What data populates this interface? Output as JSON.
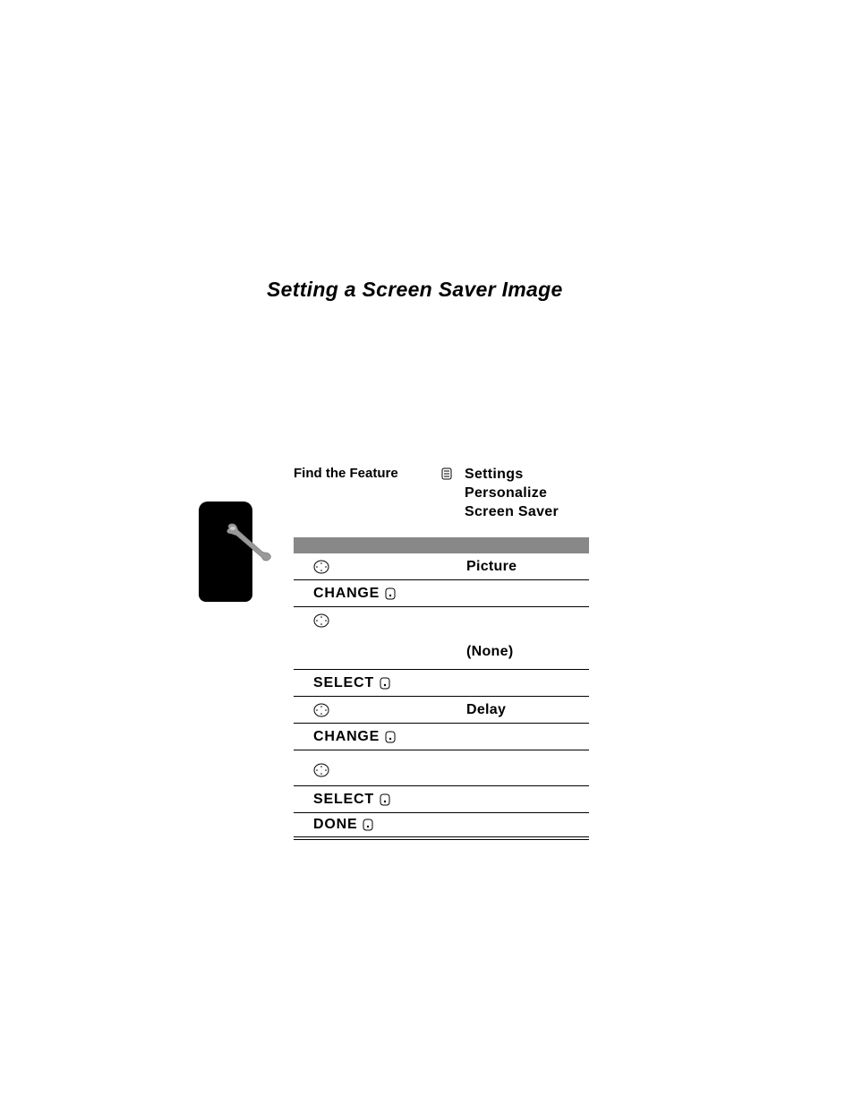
{
  "title": "Setting a Screen Saver Image",
  "findFeature": {
    "label": "Find the Feature",
    "path1": "Settings",
    "path2": "Personalize",
    "path3": "Screen Saver"
  },
  "steps": {
    "s1_to": "Picture",
    "s2_action": "CHANGE",
    "s3_to": "(None)",
    "s4_action": "SELECT",
    "s5_to": "Delay",
    "s6_action": "CHANGE",
    "s8_action": "SELECT",
    "s9_action": "DONE"
  }
}
